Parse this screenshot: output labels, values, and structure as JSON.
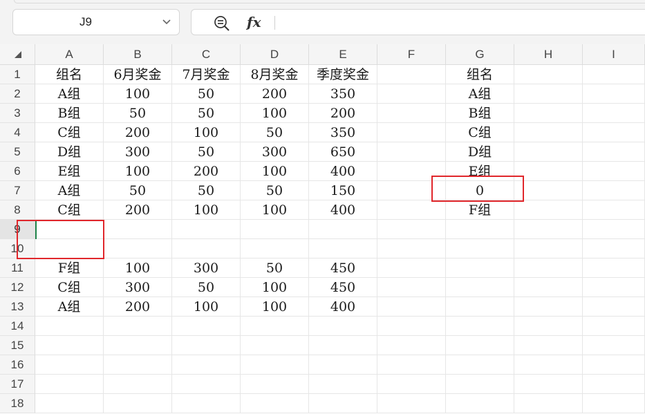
{
  "formula_bar": {
    "name_box": "J9",
    "formula": "",
    "icons": [
      "zoom-out-icon",
      "fx-icon",
      "chevron-down-icon"
    ],
    "fx_label": "fx"
  },
  "columns": [
    "A",
    "B",
    "C",
    "D",
    "E",
    "F",
    "G",
    "H",
    "I"
  ],
  "rows": [
    "1",
    "2",
    "3",
    "4",
    "5",
    "6",
    "7",
    "8",
    "9",
    "10",
    "11",
    "12",
    "13",
    "14",
    "15",
    "16",
    "17",
    "18"
  ],
  "active_cell": "J9",
  "table_main": {
    "header": [
      "组名",
      "6月奖金",
      "7月奖金",
      "8月奖金",
      "季度奖金"
    ],
    "rows": [
      [
        "A组",
        "100",
        "50",
        "200",
        "350"
      ],
      [
        "B组",
        "50",
        "50",
        "100",
        "200"
      ],
      [
        "C组",
        "200",
        "100",
        "50",
        "350"
      ],
      [
        "D组",
        "300",
        "50",
        "300",
        "650"
      ],
      [
        "E组",
        "100",
        "200",
        "100",
        "400"
      ],
      [
        "A组",
        "50",
        "50",
        "50",
        "150"
      ],
      [
        "C组",
        "200",
        "100",
        "100",
        "400"
      ],
      [
        "",
        "",
        "",
        "",
        ""
      ],
      [
        "",
        "",
        "",
        "",
        ""
      ],
      [
        "F组",
        "100",
        "300",
        "50",
        "450"
      ],
      [
        "C组",
        "300",
        "50",
        "100",
        "450"
      ],
      [
        "A组",
        "200",
        "100",
        "100",
        "400"
      ]
    ]
  },
  "column_g": [
    "组名",
    "A组",
    "B组",
    "C组",
    "D组",
    "E组",
    "0",
    "F组"
  ],
  "colors": {
    "highlight_border": "#e0262b",
    "selection_border": "#1e8449",
    "header_bg": "#f5f5f5",
    "grid_line": "#e6e6e6"
  }
}
